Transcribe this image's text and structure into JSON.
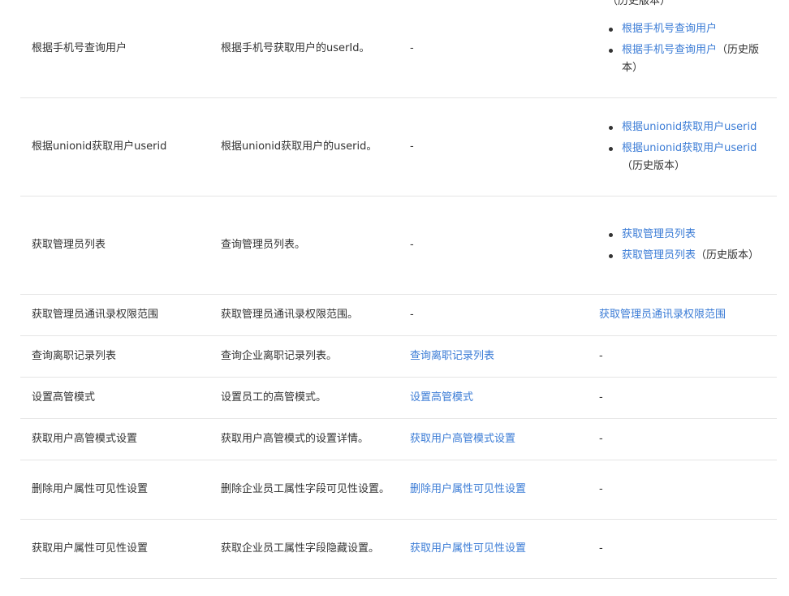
{
  "top_partial_text": "（历史版本）",
  "rows": [
    {
      "name": "根据手机号查询用户",
      "desc": "根据手机号获取用户的userId。",
      "new_api": "-",
      "old_refs": [
        {
          "link": "根据手机号查询用户",
          "suffix": ""
        },
        {
          "link": "根据手机号查询用户",
          "suffix": "（历史版本）"
        }
      ]
    },
    {
      "name": "根据unionid获取用户userid",
      "desc": "根据unionid获取用户的userid。",
      "new_api": "-",
      "old_refs": [
        {
          "link": "根据unionid获取用户userid",
          "suffix": ""
        },
        {
          "link": "根据unionid获取用户userid",
          "suffix": "（历史版本）"
        }
      ]
    },
    {
      "name": "获取管理员列表",
      "desc": "查询管理员列表。",
      "new_api": "-",
      "old_refs": [
        {
          "link": "获取管理员列表",
          "suffix": ""
        },
        {
          "link": "获取管理员列表",
          "suffix": "（历史版本）"
        }
      ]
    },
    {
      "name": "获取管理员通讯录权限范围",
      "desc": "获取管理员通讯录权限范围。",
      "new_api": "-",
      "old_link": "获取管理员通讯录权限范围"
    },
    {
      "name": "查询离职记录列表",
      "desc": "查询企业离职记录列表。",
      "new_api_link": "查询离职记录列表",
      "old": "-"
    },
    {
      "name": "设置高管模式",
      "desc": "设置员工的高管模式。",
      "new_api_link": "设置高管模式",
      "old": "-"
    },
    {
      "name": "获取用户高管模式设置",
      "desc": "获取用户高管模式的设置详情。",
      "new_api_link": "获取用户高管模式设置",
      "old": "-"
    },
    {
      "name": "删除用户属性可见性设置",
      "desc": "删除企业员工属性字段可见性设置。",
      "new_api_link": "删除用户属性可见性设置",
      "old": "-"
    },
    {
      "name": "获取用户属性可见性设置",
      "desc": "获取企业员工属性字段隐藏设置。",
      "new_api_link": "获取用户属性可见性设置",
      "old": "-"
    }
  ]
}
